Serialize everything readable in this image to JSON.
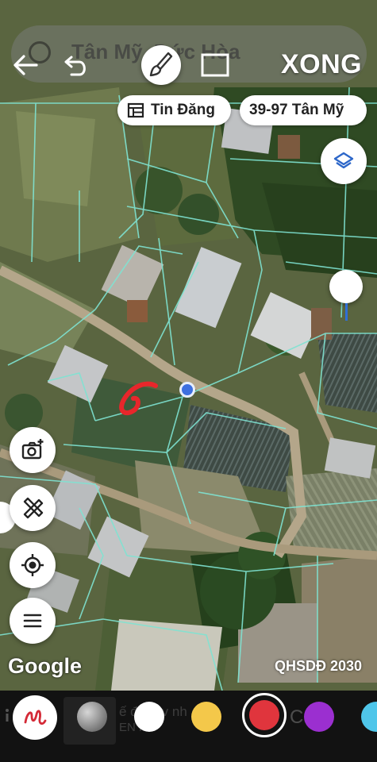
{
  "search": {
    "title": "Tân Mỹ, Đức Hòa"
  },
  "toolbar": {
    "done_label": "XONG",
    "back_icon": "back-arrow-icon",
    "undo_icon": "undo-icon",
    "brush_icon": "brush-icon",
    "rect_icon": "rectangle-icon"
  },
  "chips": {
    "listing_label": "Tin Đăng",
    "address_label": "39-97 Tân Mỹ"
  },
  "map": {
    "attribution": "Google",
    "plan_label": "QHSDĐ 2030",
    "parcel_line_color": "#7fe3d2",
    "drawn_stroke_color": "#e8262b",
    "location_color": "#3d6fe0"
  },
  "palette": {
    "ghost_line_1": "ế đơ     n v    nh",
    "ghost_line_2": "EN PR",
    "ghost_line_3": "Câ    T",
    "colors": {
      "gray": "#8a8a8a",
      "white": "#ffffff",
      "yellow": "#f4c84a",
      "red": "#e0353d",
      "purple": "#9b2fd0",
      "cyan": "#4fc6ea"
    },
    "selected": "red"
  }
}
